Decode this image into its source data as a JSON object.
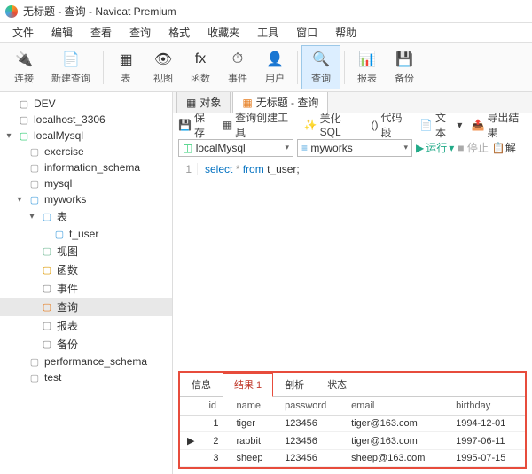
{
  "title": "无标题 - 查询 - Navicat Premium",
  "menu": [
    "文件",
    "编辑",
    "查看",
    "查询",
    "格式",
    "收藏夹",
    "工具",
    "窗口",
    "帮助"
  ],
  "toolbar": [
    {
      "id": "connect",
      "label": "连接",
      "glyph": "🔌"
    },
    {
      "id": "newquery",
      "label": "新建查询",
      "glyph": "📄"
    },
    {
      "id": "table",
      "label": "表",
      "glyph": "▦"
    },
    {
      "id": "view",
      "label": "视图",
      "glyph": "👁"
    },
    {
      "id": "func",
      "label": "函数",
      "glyph": "fx"
    },
    {
      "id": "event",
      "label": "事件",
      "glyph": "⏱"
    },
    {
      "id": "user",
      "label": "用户",
      "glyph": "👤"
    },
    {
      "id": "query",
      "label": "查询",
      "glyph": "🔍",
      "active": true
    },
    {
      "id": "report",
      "label": "报表",
      "glyph": "📊"
    },
    {
      "id": "backup",
      "label": "备份",
      "glyph": "💾"
    }
  ],
  "tree": [
    {
      "lvl": 0,
      "tw": "",
      "ic": "db",
      "color": "#888",
      "label": "DEV"
    },
    {
      "lvl": 0,
      "tw": "",
      "ic": "db",
      "color": "#888",
      "label": "localhost_3306"
    },
    {
      "lvl": 0,
      "tw": "▾",
      "ic": "db",
      "color": "#2ecc71",
      "label": "localMysql"
    },
    {
      "lvl": 1,
      "tw": "",
      "ic": "cyl",
      "color": "#999",
      "label": "exercise"
    },
    {
      "lvl": 1,
      "tw": "",
      "ic": "cyl",
      "color": "#999",
      "label": "information_schema"
    },
    {
      "lvl": 1,
      "tw": "",
      "ic": "cyl",
      "color": "#999",
      "label": "mysql"
    },
    {
      "lvl": 1,
      "tw": "▾",
      "ic": "cyl",
      "color": "#4aa3df",
      "label": "myworks"
    },
    {
      "lvl": 2,
      "tw": "▾",
      "ic": "tbl",
      "color": "#4aa3df",
      "label": "表"
    },
    {
      "lvl": 3,
      "tw": "",
      "ic": "tbl",
      "color": "#4aa3df",
      "label": "t_user"
    },
    {
      "lvl": 2,
      "tw": "",
      "ic": "view",
      "color": "#7b9",
      "label": "视图"
    },
    {
      "lvl": 2,
      "tw": "",
      "ic": "fx",
      "color": "#d90",
      "label": "函数"
    },
    {
      "lvl": 2,
      "tw": "",
      "ic": "evt",
      "color": "#888",
      "label": "事件"
    },
    {
      "lvl": 2,
      "tw": "",
      "ic": "qry",
      "color": "#e67e22",
      "label": "查询",
      "sel": true
    },
    {
      "lvl": 2,
      "tw": "",
      "ic": "rpt",
      "color": "#888",
      "label": "报表"
    },
    {
      "lvl": 2,
      "tw": "",
      "ic": "bak",
      "color": "#888",
      "label": "备份"
    },
    {
      "lvl": 1,
      "tw": "",
      "ic": "cyl",
      "color": "#999",
      "label": "performance_schema"
    },
    {
      "lvl": 1,
      "tw": "",
      "ic": "cyl",
      "color": "#999",
      "label": "test"
    }
  ],
  "tabs": {
    "objects": "对象",
    "query": "无标题 - 查询"
  },
  "qtool": {
    "save": "保存",
    "builder": "查询创建工具",
    "beautify": "美化 SQL",
    "snippet": "代码段",
    "text": "文本",
    "export": "导出结果"
  },
  "selectors": {
    "conn": "localMysql",
    "db": "myworks",
    "run": "运行",
    "stop": "停止",
    "explain": "解"
  },
  "sql": {
    "line": "1",
    "kw1": "select",
    "op": "*",
    "kw2": "from",
    "tbl": "t_user;"
  },
  "rtabs": [
    "信息",
    "结果 1",
    "剖析",
    "状态"
  ],
  "columns": [
    "id",
    "name",
    "password",
    "email",
    "birthday"
  ],
  "rows": [
    {
      "ptr": "",
      "id": "1",
      "name": "tiger",
      "password": "123456",
      "email": "tiger@163.com",
      "birthday": "1994-12-01"
    },
    {
      "ptr": "▶",
      "id": "2",
      "name": "rabbit",
      "password": "123456",
      "email": "tiger@163.com",
      "birthday": "1997-06-11"
    },
    {
      "ptr": "",
      "id": "3",
      "name": "sheep",
      "password": "123456",
      "email": "sheep@163.com",
      "birthday": "1995-07-15"
    }
  ]
}
